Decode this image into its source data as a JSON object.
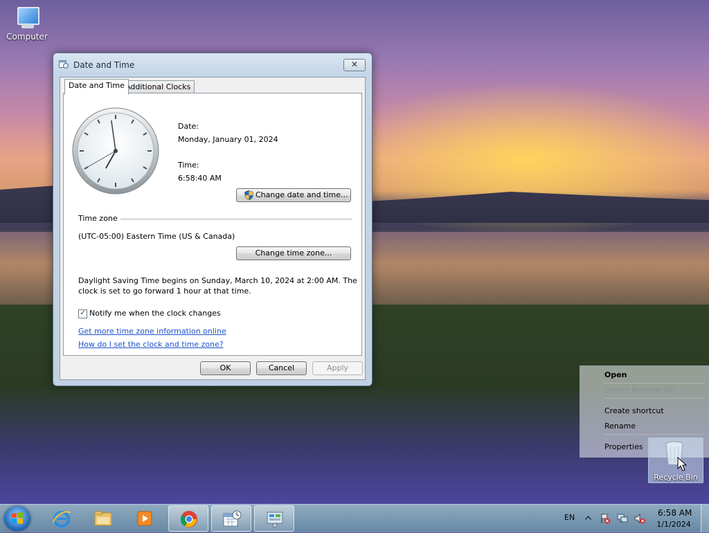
{
  "desktop": {
    "computer_label": "Computer",
    "recycle_label": "Recycle Bin"
  },
  "dialog": {
    "title": "Date and Time",
    "close_glyph": "✕",
    "tabs": [
      {
        "label": "Date and Time",
        "active": true
      },
      {
        "label": "Additional Clocks",
        "active": false
      }
    ],
    "date_label": "Date:",
    "date_value": "Monday, January 01, 2024",
    "time_label": "Time:",
    "time_value": "6:58:40 AM",
    "clock": {
      "hour": 6,
      "minute": 58,
      "second": 40
    },
    "change_datetime_button": "Change date and time...",
    "timezone_heading": "Time zone",
    "timezone_value": "(UTC-05:00) Eastern Time (US & Canada)",
    "change_timezone_button": "Change time zone...",
    "dst_line1": "Daylight Saving Time begins on Sunday, March 10, 2024 at 2:00 AM. The",
    "dst_line2": "clock is set to go forward 1 hour at that time.",
    "notify_label": "Notify me when the clock changes",
    "notify_checked": true,
    "link1": "Get more time zone information online",
    "link2": "How do I set the clock and time zone?",
    "ok_button": "OK",
    "cancel_button": "Cancel",
    "apply_button": "Apply"
  },
  "context_menu": {
    "open": "Open",
    "empty": "Empty Recycle Bin",
    "create_shortcut": "Create shortcut",
    "rename": "Rename",
    "properties": "Properties"
  },
  "taskbar": {
    "language": "EN",
    "time": "6:58 AM",
    "date": "1/1/2024"
  }
}
